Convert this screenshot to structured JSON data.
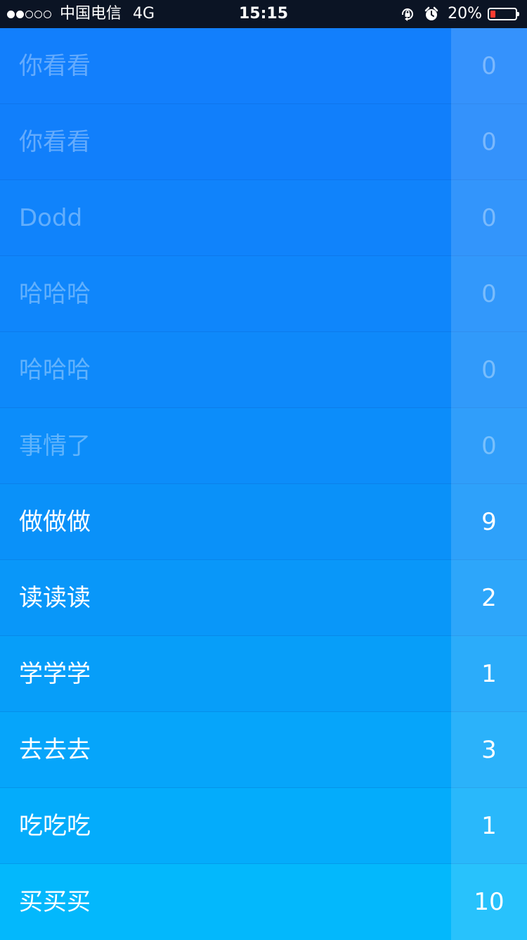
{
  "status_bar": {
    "signal_strength": 2,
    "signal_total": 5,
    "carrier": "中国电信",
    "network": "4G",
    "time": "15:15",
    "icons": [
      "rotation-lock-icon",
      "alarm-icon",
      "battery-icon"
    ],
    "battery_percent": "20%",
    "battery_level": 0.2,
    "battery_color": "#ff3b30"
  },
  "list": {
    "items": [
      {
        "label": "你看看",
        "count": "0",
        "done": true
      },
      {
        "label": "你看看",
        "count": "0",
        "done": true
      },
      {
        "label": "Dodd",
        "count": "0",
        "done": true
      },
      {
        "label": "哈哈哈",
        "count": "0",
        "done": true
      },
      {
        "label": "哈哈哈",
        "count": "0",
        "done": true
      },
      {
        "label": "事情了",
        "count": "0",
        "done": true
      },
      {
        "label": "做做做",
        "count": "9",
        "done": false
      },
      {
        "label": "读读读",
        "count": "2",
        "done": false
      },
      {
        "label": "学学学",
        "count": "1",
        "done": false
      },
      {
        "label": "去去去",
        "count": "3",
        "done": false
      },
      {
        "label": "吃吃吃",
        "count": "1",
        "done": false
      },
      {
        "label": "买买买",
        "count": "10",
        "done": false
      }
    ]
  },
  "colors": {
    "status_bar_bg": "#0b1424",
    "row_colors": [
      "#127ffc",
      "#117ffb",
      "#1083fb",
      "#0f86fb",
      "#0e89fa",
      "#0c8dfa",
      "#0a91f9",
      "#0997f9",
      "#079ef9",
      "#06a5fa",
      "#04acfb",
      "#03b8fc"
    ]
  }
}
